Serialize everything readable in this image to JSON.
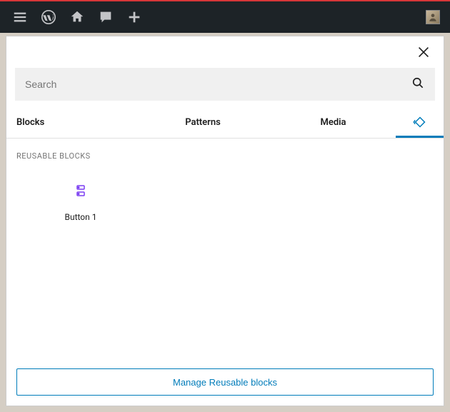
{
  "search": {
    "placeholder": "Search"
  },
  "tabs": {
    "blocks": "Blocks",
    "patterns": "Patterns",
    "media": "Media"
  },
  "section": {
    "reusable_title": "REUSABLE BLOCKS"
  },
  "blocks": [
    {
      "label": "Button 1"
    }
  ],
  "footer": {
    "manage_label": "Manage Reusable blocks"
  }
}
